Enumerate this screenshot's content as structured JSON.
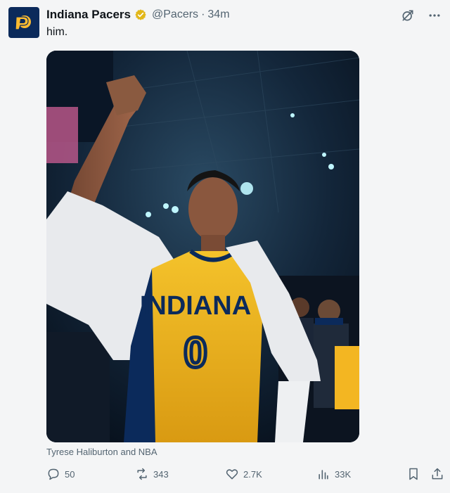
{
  "author": {
    "name": "Indiana Pacers",
    "handle": "@Pacers",
    "separator": "·",
    "time": "34m",
    "avatar_icon": "pacers-logo-icon",
    "verified_icon": "verified-gold-badge-icon",
    "brand_color": "#0b2a5b",
    "accent_color": "#fdbb30"
  },
  "tweet": {
    "text": "him.",
    "media_caption": "Tyrese Haliburton and NBA",
    "jersey_text": "INDIANA",
    "jersey_number": "0"
  },
  "header_icons": {
    "grok": "grok-icon",
    "more": "more-icon"
  },
  "actions": {
    "replies": "50",
    "reposts": "343",
    "likes": "2.7K",
    "views": "33K",
    "reply_icon": "reply-icon",
    "repost_icon": "repost-icon",
    "like_icon": "heart-icon",
    "views_icon": "views-chart-icon",
    "bookmark_icon": "bookmark-icon",
    "share_icon": "share-icon"
  }
}
